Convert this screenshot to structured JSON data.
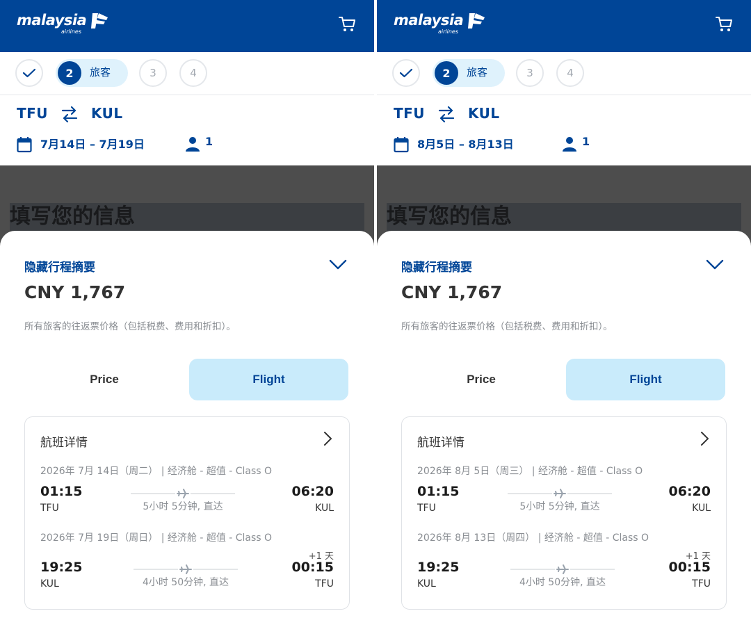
{
  "colors": {
    "brand": "#004597",
    "tab_active": "#c9ebfb",
    "step_active_bg": "#dff2fc"
  },
  "panels": [
    {
      "header": {
        "logo_text": "malaysia",
        "logo_sub": "airlines",
        "cart_icon": "cart-icon"
      },
      "stepper": {
        "step1_icon": "check-icon",
        "step2_num": "2",
        "step2_label": "旅客",
        "step3": "3",
        "step4": "4"
      },
      "route": {
        "origin": "TFU",
        "destination": "KUL",
        "dates": "7月14日 – 7月19日",
        "passengers": "1"
      },
      "page_title": "填写您的信息",
      "summary": {
        "title": "隐藏行程摘要",
        "total": "CNY 1,767",
        "note": "所有旅客的往返票价格（包括税费、费用和折扣）。",
        "tab_price": "Price",
        "tab_flight": "Flight",
        "card_title": "航班详情",
        "outbound": {
          "meta": "2026年 7月 14日（周二） | 经济舱 - 超值 - Class O",
          "dep_time": "01:15",
          "dep_code": "TFU",
          "duration": "5小时 5分钟, 直达",
          "arr_time": "06:20",
          "arr_code": "KUL"
        },
        "inbound": {
          "meta": "2026年 7月 19日（周日） | 经济舱 - 超值 - Class O",
          "dep_time": "19:25",
          "dep_code": "KUL",
          "duration": "4小时 50分钟, 直达",
          "arr_time": "00:15",
          "arr_code": "TFU",
          "plus_day": "+1 天"
        }
      }
    },
    {
      "header": {
        "logo_text": "malaysia",
        "logo_sub": "airlines",
        "cart_icon": "cart-icon"
      },
      "stepper": {
        "step1_icon": "check-icon",
        "step2_num": "2",
        "step2_label": "旅客",
        "step3": "3",
        "step4": "4"
      },
      "route": {
        "origin": "TFU",
        "destination": "KUL",
        "dates": "8月5日 – 8月13日",
        "passengers": "1"
      },
      "page_title": "填写您的信息",
      "summary": {
        "title": "隐藏行程摘要",
        "total": "CNY 1,767",
        "note": "所有旅客的往返票价格（包括税费、费用和折扣）。",
        "tab_price": "Price",
        "tab_flight": "Flight",
        "card_title": "航班详情",
        "outbound": {
          "meta": "2026年 8月 5日（周三） | 经济舱 - 超值 - Class O",
          "dep_time": "01:15",
          "dep_code": "TFU",
          "duration": "5小时 5分钟, 直达",
          "arr_time": "06:20",
          "arr_code": "KUL"
        },
        "inbound": {
          "meta": "2026年 8月 13日（周四） | 经济舱 - 超值 - Class O",
          "dep_time": "19:25",
          "dep_code": "KUL",
          "duration": "4小时 50分钟, 直达",
          "arr_time": "00:15",
          "arr_code": "TFU",
          "plus_day": "+1 天"
        }
      }
    }
  ]
}
